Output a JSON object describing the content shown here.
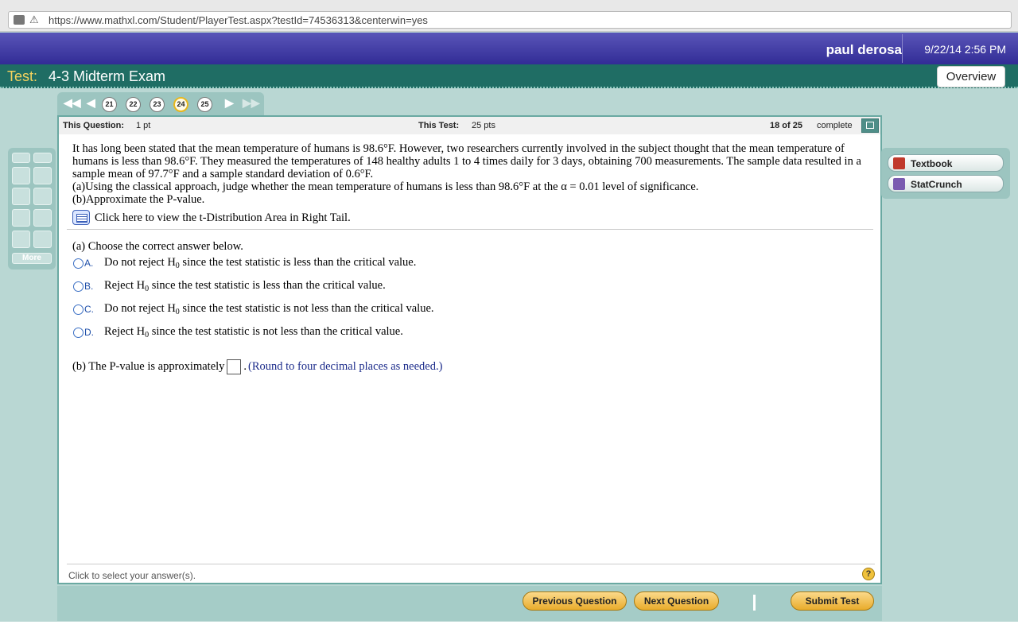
{
  "browser": {
    "url": "https://www.mathxl.com/Student/PlayerTest.aspx?testId=74536313&centerwin=yes"
  },
  "header": {
    "user_name": "paul derosa",
    "datetime": "9/22/14 2:56 PM"
  },
  "title": {
    "label": "Test:",
    "name": "4-3 Midterm Exam",
    "overview_label": "Overview"
  },
  "nav": {
    "questions": [
      "21",
      "22",
      "23",
      "24",
      "25"
    ],
    "current": "24"
  },
  "info": {
    "this_question_label": "This Question:",
    "this_question_value": "1 pt",
    "this_test_label": "This Test:",
    "this_test_value": "25 pts",
    "progress_count": "18 of 25",
    "progress_label": "complete"
  },
  "question": {
    "line1": "It has long been stated that the mean temperature of humans is 98.6°F. However, two researchers currently involved in the subject thought that the mean temperature of humans is less than 98.6°F. They measured the temperatures of 148 healthy adults 1 to 4 times daily for 3 days, obtaining 700 measurements. The sample data resulted in a sample mean of 97.7°F and a sample standard deviation of 0.6°F.",
    "line2": "(a)Using the classical approach, judge whether the mean temperature of humans is less than 98.6°F at the α = 0.01 level of significance.",
    "line3": "(b)Approximate the P-value.",
    "tdist_link": "Click here to view the t-Distribution Area in Right Tail."
  },
  "part_a": {
    "prompt": "(a) Choose the correct answer below.",
    "options": [
      {
        "letter": "A.",
        "pre": "Do not reject H",
        "sub": "0",
        "post": " since the test statistic is less than the critical value."
      },
      {
        "letter": "B.",
        "pre": "Reject H",
        "sub": "0",
        "post": " since the test statistic is less than the critical value."
      },
      {
        "letter": "C.",
        "pre": "Do not reject H",
        "sub": "0",
        "post": " since the test statistic is not less than the critical value."
      },
      {
        "letter": "D.",
        "pre": "Reject H",
        "sub": "0",
        "post": " since the test statistic is not less than the critical value."
      }
    ]
  },
  "part_b": {
    "prompt": "(b) The P-value is approximately",
    "after": ".",
    "hint": "(Round to four decimal places as needed.)"
  },
  "footer": {
    "status": "Click to select your answer(s).",
    "help": "?"
  },
  "left_tools": {
    "more_label": "More"
  },
  "resources": {
    "textbook": "Textbook",
    "statcrunch": "StatCrunch"
  },
  "buttons": {
    "previous": "Previous Question",
    "next": "Next Question",
    "submit": "Submit Test"
  },
  "colors": {
    "header": "#3a349c",
    "titlebar": "#1f6d64",
    "accent": "#f4d35e",
    "page_bg": "#b9d7d3",
    "button": "#f0c05a"
  }
}
